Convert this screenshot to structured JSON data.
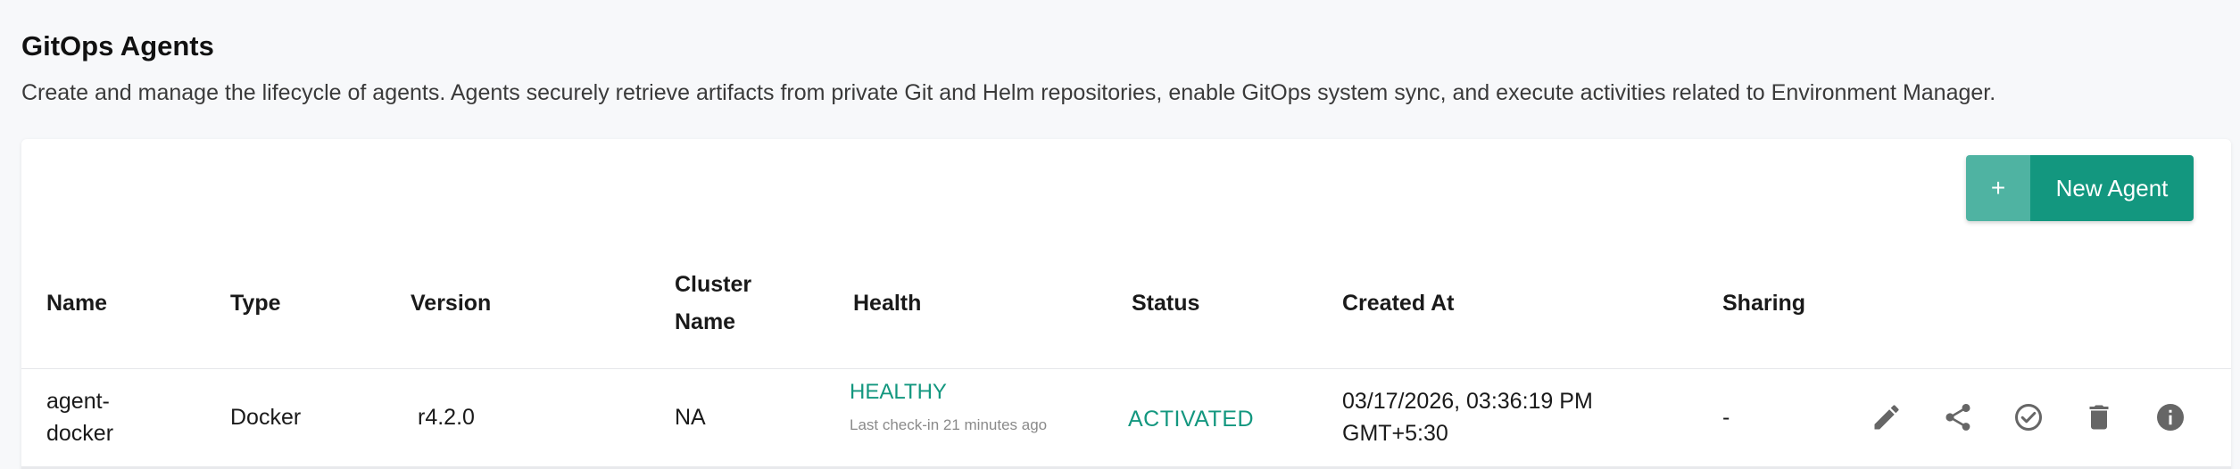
{
  "header": {
    "title": "GitOps Agents",
    "description": "Create and manage the lifecycle of agents. Agents securely retrieve artifacts from private Git and Helm repositories, enable GitOps system sync, and execute activities related to Environment Manager."
  },
  "toolbar": {
    "new_agent_plus": "+",
    "new_agent_label": "New Agent"
  },
  "table": {
    "columns": {
      "name": "Name",
      "type": "Type",
      "version": "Version",
      "cluster_name": "Cluster Name",
      "health": "Health",
      "status": "Status",
      "created_at": "Created At",
      "sharing": "Sharing"
    },
    "rows": [
      {
        "name": "agent-docker",
        "type": "Docker",
        "version": "r4.2.0",
        "cluster_name": "NA",
        "health": "HEALTHY",
        "health_detail": "Last check-in  21 minutes ago",
        "status": "ACTIVATED",
        "created_at": "03/17/2026, 03:36:19 PM GMT+5:30",
        "sharing": "-",
        "actions": [
          "edit-icon",
          "share-icon",
          "check-circle-icon",
          "delete-icon",
          "info-icon"
        ]
      }
    ]
  },
  "colors": {
    "accent": "#13977f",
    "accent_light": "#4fb3a2",
    "icon_gray": "#666666"
  }
}
